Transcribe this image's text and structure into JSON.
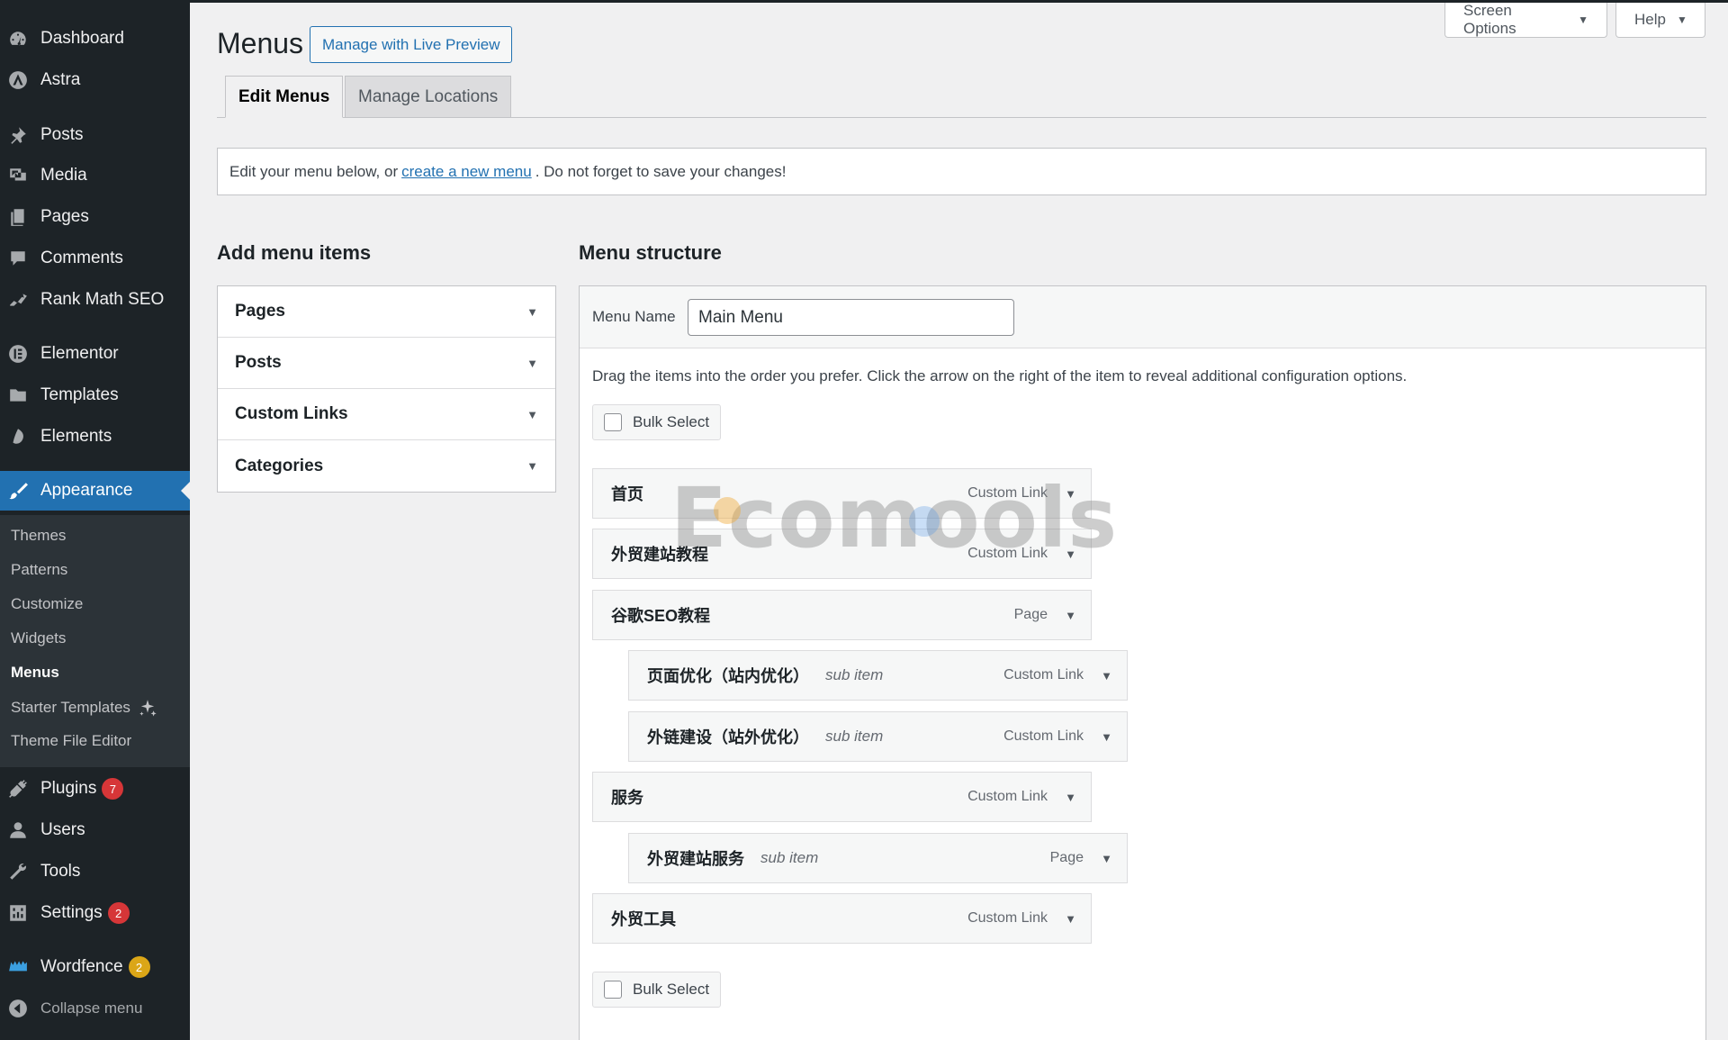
{
  "sidebar": {
    "items": [
      {
        "label": "Dashboard",
        "icon": "dashboard-icon"
      },
      {
        "label": "Astra",
        "icon": "astra-icon"
      },
      {
        "label": "Posts",
        "icon": "pin-icon"
      },
      {
        "label": "Media",
        "icon": "media-icon"
      },
      {
        "label": "Pages",
        "icon": "pages-icon"
      },
      {
        "label": "Comments",
        "icon": "comments-icon"
      },
      {
        "label": "Rank Math SEO",
        "icon": "rank-math-icon"
      },
      {
        "label": "Elementor",
        "icon": "elementor-icon"
      },
      {
        "label": "Templates",
        "icon": "folder-icon"
      },
      {
        "label": "Elements",
        "icon": "elements-icon"
      },
      {
        "label": "Appearance",
        "icon": "brush-icon"
      },
      {
        "label": "Plugins",
        "icon": "plugin-icon",
        "badge": "7"
      },
      {
        "label": "Users",
        "icon": "users-icon"
      },
      {
        "label": "Tools",
        "icon": "wrench-icon"
      },
      {
        "label": "Settings",
        "icon": "settings-icon",
        "badge": "2"
      },
      {
        "label": "Wordfence",
        "icon": "wordfence-icon",
        "badge": "2"
      },
      {
        "label": "Collapse menu",
        "icon": "collapse-icon"
      }
    ],
    "submenu": [
      "Themes",
      "Patterns",
      "Customize",
      "Widgets",
      "Menus",
      "Starter Templates",
      "Theme File Editor"
    ],
    "colors": {
      "background": "#1d2327",
      "active": "#2271b1",
      "submenu": "#2c3338",
      "badge_red": "#d63638",
      "badge_orange": "#dba617"
    }
  },
  "screen_meta": {
    "screen_options": "Screen Options",
    "help": "Help"
  },
  "header": {
    "title": "Menus",
    "live_preview": "Manage with Live Preview"
  },
  "tabs": [
    {
      "label": "Edit Menus",
      "active": true
    },
    {
      "label": "Manage Locations",
      "active": false
    }
  ],
  "notice": {
    "before": "Edit your menu below, or",
    "link": "create a new menu",
    "after": ". Do not forget to save your changes!"
  },
  "add_items": {
    "title": "Add menu items",
    "sections": [
      "Pages",
      "Posts",
      "Custom Links",
      "Categories"
    ]
  },
  "structure": {
    "title": "Menu structure",
    "menu_name_label": "Menu Name",
    "menu_name_value": "Main Menu",
    "instructions": "Drag the items into the order you prefer. Click the arrow on the right of the item to reveal additional configuration options.",
    "bulk_select": "Bulk Select",
    "items": [
      {
        "title": "首页",
        "type": "Custom Link",
        "sub": ""
      },
      {
        "title": "外贸建站教程",
        "type": "Custom Link",
        "sub": ""
      },
      {
        "title": "谷歌SEO教程",
        "type": "Page",
        "sub": ""
      },
      {
        "title": "页面优化（站内优化）",
        "type": "Custom Link",
        "sub": "sub item"
      },
      {
        "title": "外链建设（站外优化）",
        "type": "Custom Link",
        "sub": "sub item"
      },
      {
        "title": "服务",
        "type": "Custom Link",
        "sub": ""
      },
      {
        "title": "外贸建站服务",
        "type": "Page",
        "sub": "sub item"
      },
      {
        "title": "外贸工具",
        "type": "Custom Link",
        "sub": ""
      }
    ]
  },
  "watermark": "Ecomools"
}
